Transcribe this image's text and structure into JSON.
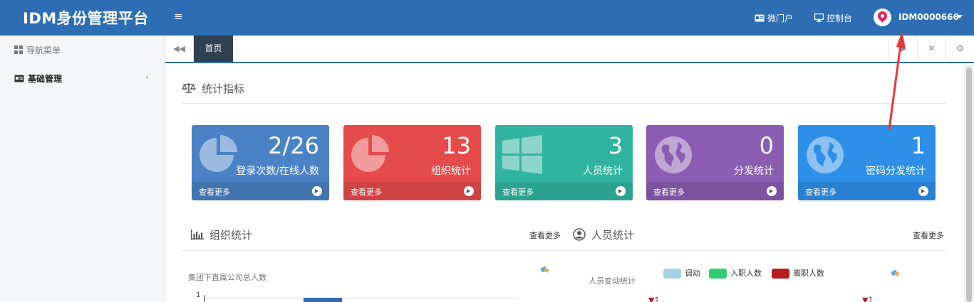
{
  "header": {
    "title": "IDM身份管理平台",
    "menu_toggle": "≡",
    "links": [
      {
        "label": "微门户",
        "icon": "id-card-icon"
      },
      {
        "label": "控制台",
        "icon": "monitor-icon"
      }
    ],
    "user": {
      "name": "IDM0000666",
      "avatar_icon": "location-pin-icon"
    }
  },
  "sidebar": {
    "nav_title": "导航菜单",
    "items": [
      {
        "label": "基础管理",
        "icon": "id-card-icon",
        "chevron": "‹"
      }
    ]
  },
  "tabs": {
    "prev": "◀◀",
    "active": "首页",
    "next": "▶",
    "tools": [
      "✕",
      "⚙"
    ]
  },
  "stats": {
    "title": "统计指标",
    "cards": [
      {
        "value": "2/26",
        "label": "登录次数/在线人数",
        "more": "查看更多",
        "color": "#4a82c5",
        "icon": "pie-chart-icon"
      },
      {
        "value": "13",
        "label": "组织统计",
        "more": "查看更多",
        "color": "#e64b4b",
        "icon": "pie-chart-icon"
      },
      {
        "value": "3",
        "label": "人员统计",
        "more": "查看更多",
        "color": "#30b4a0",
        "icon": "windows-icon"
      },
      {
        "value": "0",
        "label": "分发统计",
        "more": "查看更多",
        "color": "#8a5db2",
        "icon": "globe-icon"
      },
      {
        "value": "1",
        "label": "密码分发统计",
        "more": "查看更多",
        "color": "#2e8fe8",
        "icon": "globe-icon"
      }
    ]
  },
  "org_section": {
    "title": "组织统计",
    "more": "查看更多",
    "chart_title": "集团下直属公司总人数",
    "axis_tick": "1"
  },
  "person_section": {
    "title": "人员统计",
    "more": "查看更多",
    "chart_title": "人员变动统计",
    "legend": [
      {
        "label": "调动",
        "color": "#a3d2e3"
      },
      {
        "label": "入职人数",
        "color": "#2ecc71"
      },
      {
        "label": "离职人数",
        "color": "#b71c1c"
      }
    ],
    "bar_label_1": "1",
    "bar_label_2": "1"
  }
}
